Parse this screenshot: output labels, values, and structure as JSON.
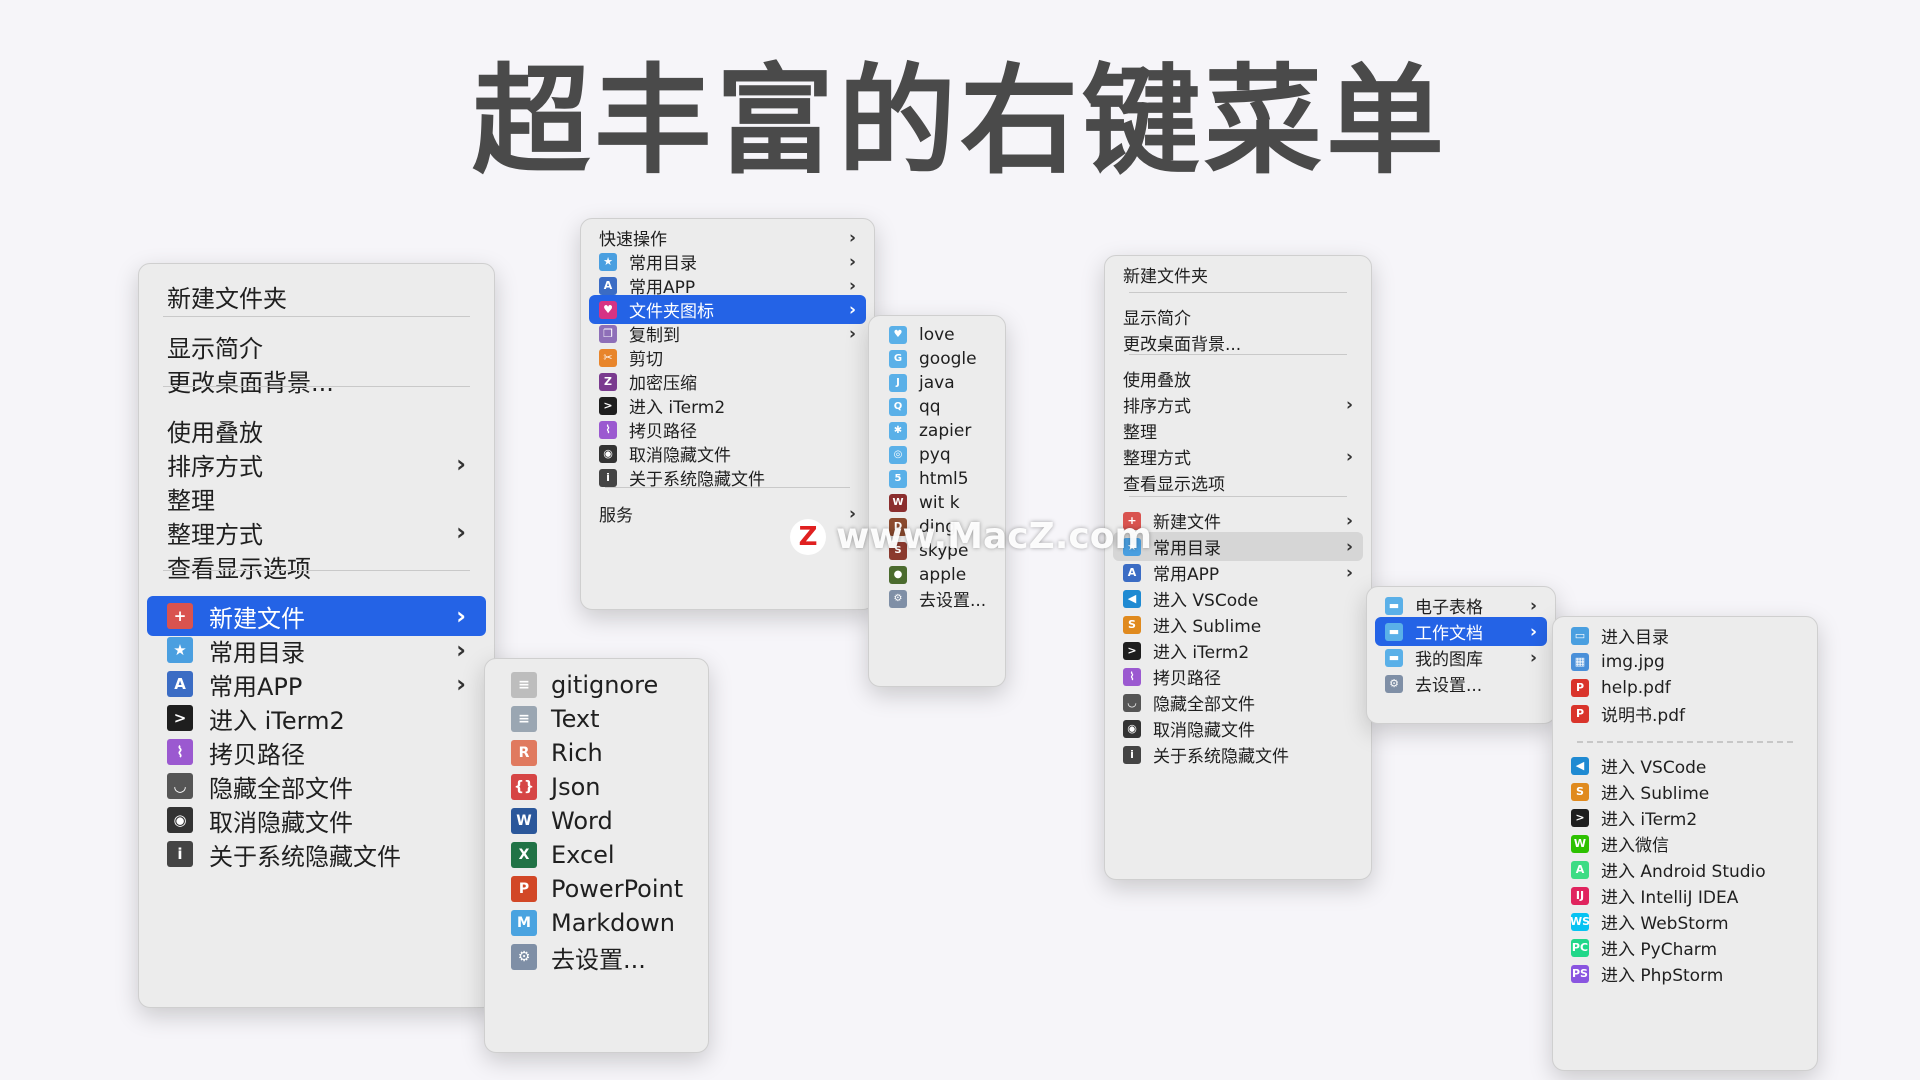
{
  "title": "超丰富的右键菜单",
  "watermark": "www.MacZ.com",
  "watermark_logo": "Z",
  "menu1": {
    "items": [
      {
        "label": "新建文件夹"
      },
      {
        "label": "显示简介"
      },
      {
        "label": "更改桌面背景..."
      },
      {
        "label": "使用叠放"
      },
      {
        "label": "排序方式",
        "arrow": "›"
      },
      {
        "label": "整理"
      },
      {
        "label": "整理方式",
        "arrow": "›"
      },
      {
        "label": "查看显示选项"
      },
      {
        "label": "新建文件",
        "arrow": "›",
        "icon": "new-file-icon",
        "glyph": "+"
      },
      {
        "label": "常用目录",
        "arrow": "›",
        "icon": "folder-star-icon",
        "glyph": "★"
      },
      {
        "label": "常用APP",
        "arrow": "›",
        "icon": "app-store-icon",
        "glyph": "A"
      },
      {
        "label": "进入 iTerm2",
        "icon": "terminal-icon",
        "glyph": ">"
      },
      {
        "label": "拷贝路径",
        "icon": "path-icon",
        "glyph": "⌇"
      },
      {
        "label": "隐藏全部文件",
        "icon": "eye-closed-icon",
        "glyph": "◡"
      },
      {
        "label": "取消隐藏文件",
        "icon": "eye-icon",
        "glyph": "◉"
      },
      {
        "label": "关于系统隐藏文件",
        "icon": "info-icon",
        "glyph": "i"
      }
    ]
  },
  "menu2": {
    "items": [
      {
        "label": "gitignore",
        "icon": "gitignore-file-icon",
        "glyph": "≡"
      },
      {
        "label": "Text",
        "icon": "text-file-icon",
        "glyph": "≡"
      },
      {
        "label": "Rich",
        "icon": "rtf-file-icon",
        "glyph": "R"
      },
      {
        "label": "Json",
        "icon": "json-file-icon",
        "glyph": "{}"
      },
      {
        "label": "Word",
        "icon": "word-icon",
        "glyph": "W"
      },
      {
        "label": "Excel",
        "icon": "excel-icon",
        "glyph": "X"
      },
      {
        "label": "PowerPoint",
        "icon": "powerpoint-icon",
        "glyph": "P"
      },
      {
        "label": "Markdown",
        "icon": "markdown-icon",
        "glyph": "M"
      },
      {
        "label": "去设置...",
        "icon": "gear-icon",
        "glyph": "⚙"
      }
    ]
  },
  "menu3": {
    "items": [
      {
        "label": "快速操作",
        "arrow": "›"
      },
      {
        "label": "常用目录",
        "arrow": "›",
        "icon": "folder-star-icon",
        "glyph": "★"
      },
      {
        "label": "常用APP",
        "arrow": "›",
        "icon": "app-store-icon",
        "glyph": "A"
      },
      {
        "label": "文件夹图标",
        "arrow": "›",
        "icon": "folder-heart-icon",
        "glyph": "♥"
      },
      {
        "label": "复制到",
        "arrow": "›",
        "icon": "copy-icon",
        "glyph": "❐"
      },
      {
        "label": "剪切",
        "icon": "scissors-icon",
        "glyph": "✂"
      },
      {
        "label": "加密压缩",
        "icon": "zip-icon",
        "glyph": "Z"
      },
      {
        "label": "进入 iTerm2",
        "icon": "terminal-icon",
        "glyph": ">"
      },
      {
        "label": "拷贝路径",
        "icon": "path-icon",
        "glyph": "⌇"
      },
      {
        "label": "取消隐藏文件",
        "icon": "eye-icon",
        "glyph": "◉"
      },
      {
        "label": "关于系统隐藏文件",
        "icon": "info-icon",
        "glyph": "i"
      },
      {
        "label": "服务",
        "arrow": "›"
      }
    ]
  },
  "menu4": {
    "items": [
      {
        "label": "love",
        "icon": "folder-love-icon",
        "glyph": "♥"
      },
      {
        "label": "google",
        "icon": "folder-google-icon",
        "glyph": "G"
      },
      {
        "label": "java",
        "icon": "folder-java-icon",
        "glyph": "J"
      },
      {
        "label": "qq",
        "icon": "folder-qq-icon",
        "glyph": "Q"
      },
      {
        "label": "zapier",
        "icon": "folder-zapier-icon",
        "glyph": "✱"
      },
      {
        "label": "pyq",
        "icon": "folder-pyq-icon",
        "glyph": "◎"
      },
      {
        "label": "html5",
        "icon": "folder-html5-icon",
        "glyph": "5"
      },
      {
        "label": "wit k",
        "icon": "folder-witk-icon",
        "glyph": "W"
      },
      {
        "label": "ding",
        "icon": "folder-ding-icon",
        "glyph": "D"
      },
      {
        "label": "skype",
        "icon": "folder-skype-icon",
        "glyph": "S"
      },
      {
        "label": "apple",
        "icon": "folder-apple-icon",
        "glyph": "●"
      },
      {
        "label": "去设置...",
        "icon": "gear-icon",
        "glyph": "⚙"
      }
    ]
  },
  "menu5": {
    "items": [
      {
        "label": "新建文件夹"
      },
      {
        "label": "显示简介"
      },
      {
        "label": "更改桌面背景..."
      },
      {
        "label": "使用叠放"
      },
      {
        "label": "排序方式",
        "arrow": "›"
      },
      {
        "label": "整理"
      },
      {
        "label": "整理方式",
        "arrow": "›"
      },
      {
        "label": "查看显示选项"
      },
      {
        "label": "新建文件",
        "arrow": "›",
        "icon": "new-file-icon",
        "glyph": "+"
      },
      {
        "label": "常用目录",
        "arrow": "›",
        "icon": "folder-star-icon",
        "glyph": "★"
      },
      {
        "label": "常用APP",
        "arrow": "›",
        "icon": "app-store-icon",
        "glyph": "A"
      },
      {
        "label": "进入 VSCode",
        "icon": "vscode-icon",
        "glyph": "◀"
      },
      {
        "label": "进入 Sublime",
        "icon": "sublime-icon",
        "glyph": "S"
      },
      {
        "label": "进入 iTerm2",
        "icon": "terminal-icon",
        "glyph": ">"
      },
      {
        "label": "拷贝路径",
        "icon": "path-icon",
        "glyph": "⌇"
      },
      {
        "label": "隐藏全部文件",
        "icon": "eye-closed-icon",
        "glyph": "◡"
      },
      {
        "label": "取消隐藏文件",
        "icon": "eye-icon",
        "glyph": "◉"
      },
      {
        "label": "关于系统隐藏文件",
        "icon": "info-icon",
        "glyph": "i"
      }
    ]
  },
  "menu6": {
    "items": [
      {
        "label": "电子表格",
        "arrow": "›",
        "icon": "folder-icon",
        "glyph": "▬"
      },
      {
        "label": "工作文档",
        "arrow": "›",
        "icon": "folder-icon",
        "glyph": "▬"
      },
      {
        "label": "我的图库",
        "arrow": "›",
        "icon": "folder-icon",
        "glyph": "▬"
      },
      {
        "label": "去设置...",
        "icon": "gear-icon",
        "glyph": "⚙"
      }
    ]
  },
  "menu7": {
    "items": [
      {
        "label": "进入目录",
        "icon": "folder-open-icon",
        "glyph": "▭"
      },
      {
        "label": "img.jpg",
        "icon": "image-file-icon",
        "glyph": "▦"
      },
      {
        "label": "help.pdf",
        "icon": "pdf-icon",
        "glyph": "P"
      },
      {
        "label": "说明书.pdf",
        "icon": "pdf-icon",
        "glyph": "P"
      },
      {
        "label": "进入 VSCode",
        "icon": "vscode-icon",
        "glyph": "◀"
      },
      {
        "label": "进入 Sublime",
        "icon": "sublime-icon",
        "glyph": "S"
      },
      {
        "label": "进入 iTerm2",
        "icon": "terminal-icon",
        "glyph": ">"
      },
      {
        "label": "进入微信",
        "icon": "wechat-icon",
        "glyph": "W"
      },
      {
        "label": "进入 Android Studio",
        "icon": "android-studio-icon",
        "glyph": "A"
      },
      {
        "label": "进入 IntelliJ IDEA",
        "icon": "intellij-icon",
        "glyph": "IJ"
      },
      {
        "label": "进入 WebStorm",
        "icon": "webstorm-icon",
        "glyph": "WS"
      },
      {
        "label": "进入 PyCharm",
        "icon": "pycharm-icon",
        "glyph": "PC"
      },
      {
        "label": "进入 PhpStorm",
        "icon": "phpstorm-icon",
        "glyph": "PS"
      }
    ]
  },
  "icon_colors": {
    "new-file-icon": "#d9534f",
    "folder-star-icon": "#4a9fe0",
    "app-store-icon": "#3b6cc4",
    "terminal-icon": "#1e1e1e",
    "path-icon": "#9b59d0",
    "eye-closed-icon": "#555555",
    "eye-icon": "#333333",
    "info-icon": "#444444",
    "gitignore-file-icon": "#bdbdbd",
    "text-file-icon": "#9aa6b2",
    "rtf-file-icon": "#e07a5f",
    "json-file-icon": "#d64545",
    "word-icon": "#2b579a",
    "excel-icon": "#217346",
    "powerpoint-icon": "#d24726",
    "markdown-icon": "#4aa3e0",
    "gear-icon": "#7f8fa6",
    "folder-heart-icon": "#d63384",
    "copy-icon": "#8e6fb8",
    "scissors-icon": "#e8852b",
    "zip-icon": "#7a3b8f",
    "folder-love-icon": "#5ab0e8",
    "folder-google-icon": "#5ab0e8",
    "folder-java-icon": "#5ab0e8",
    "folder-qq-icon": "#5ab0e8",
    "folder-zapier-icon": "#5ab0e8",
    "folder-pyq-icon": "#5ab0e8",
    "folder-html5-icon": "#5ab0e8",
    "folder-witk-icon": "#8b2e2e",
    "folder-ding-icon": "#8b4a2e",
    "folder-skype-icon": "#8b3a2e",
    "folder-apple-icon": "#4b6b2e",
    "vscode-icon": "#1f8ad2",
    "sublime-icon": "#e08a1e",
    "folder-icon": "#5ab0e8",
    "folder-open-icon": "#4a9fe0",
    "image-file-icon": "#4a90d9",
    "pdf-icon": "#d9342b",
    "wechat-icon": "#2dc100",
    "android-studio-icon": "#3ddc84",
    "intellij-icon": "#e0245e",
    "webstorm-icon": "#07c3f2",
    "pycharm-icon": "#21d789",
    "phpstorm-icon": "#8a55e0"
  },
  "highlight_color": "#2463e6"
}
